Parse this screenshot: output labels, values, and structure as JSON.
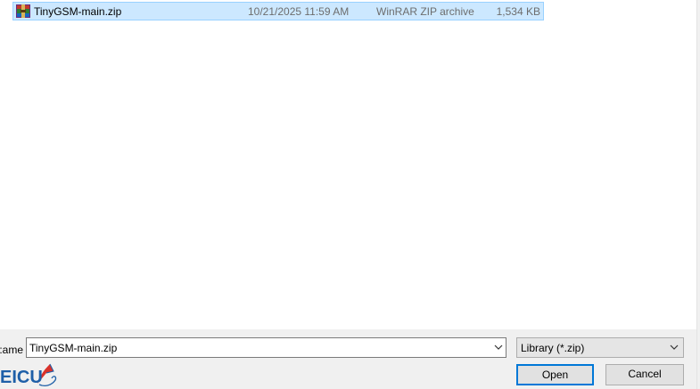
{
  "file_list": {
    "rows": [
      {
        "name": "TinyGSM-main.zip",
        "date_modified": "10/21/2025 11:59 AM",
        "type": "WinRAR ZIP archive",
        "size": "1,534 KB",
        "icon": "winrar-archive-icon",
        "selected": true
      }
    ]
  },
  "bottom_panel": {
    "filename_label": "ame:",
    "filename_value": "TinyGSM-main.zip",
    "filter_label": "Library (*.zip)",
    "open_label": "Open",
    "cancel_label": "Cancel",
    "logo_text": "EICU"
  },
  "colors": {
    "selection_fill": "#cce8ff",
    "selection_border": "#99d1ff",
    "panel_background": "#f0f0f0",
    "default_button_border": "#0078d7",
    "logo_blue": "#1e5fa8",
    "logo_red": "#d9322b"
  }
}
